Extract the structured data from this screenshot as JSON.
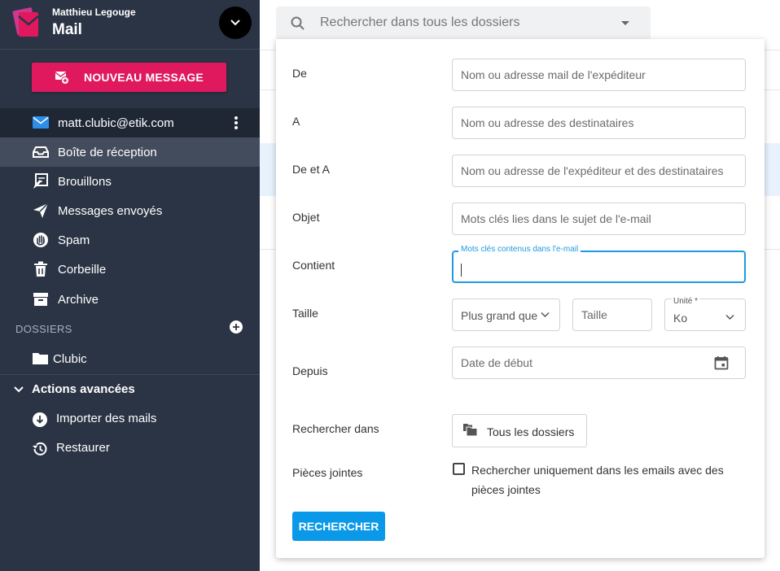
{
  "app": {
    "user_name": "Matthieu Legouge",
    "app_name": "Mail"
  },
  "sidebar": {
    "new_message_label": "NOUVEAU MESSAGE",
    "account_email": "matt.clubic@etik.com",
    "items": [
      {
        "label": "Boîte de réception",
        "icon": "inbox-icon",
        "active": true
      },
      {
        "label": "Brouillons",
        "icon": "drafts-icon"
      },
      {
        "label": "Messages envoyés",
        "icon": "send-icon"
      },
      {
        "label": "Spam",
        "icon": "spam-hand-icon"
      },
      {
        "label": "Corbeille",
        "icon": "trash-icon"
      },
      {
        "label": "Archive",
        "icon": "archive-icon"
      }
    ],
    "folders_title": "DOSSIERS",
    "folders": [
      {
        "label": "Clubic",
        "icon": "folder-icon"
      }
    ],
    "advanced_title": "Actions avancées",
    "advanced_items": [
      {
        "label": "Importer des mails",
        "icon": "download-icon"
      },
      {
        "label": "Restaurer",
        "icon": "restore-icon"
      }
    ]
  },
  "search": {
    "placeholder": "Rechercher dans tous les dossiers"
  },
  "form": {
    "from": {
      "label": "De",
      "placeholder": "Nom ou adresse mail de l'expéditeur"
    },
    "to": {
      "label": "A",
      "placeholder": "Nom ou adresse des destinataires"
    },
    "from_to": {
      "label": "De et A",
      "placeholder": "Nom ou adresse de l'expéditeur et des destinataires"
    },
    "subject": {
      "label": "Objet",
      "placeholder": "Mots clés lies dans le sujet de l'e-mail"
    },
    "contains": {
      "label": "Contient",
      "floating_label": "Mots clés contenus dans l'e-mail"
    },
    "size": {
      "label": "Taille",
      "comparator": "Plus grand que",
      "placeholder": "Taille",
      "unit_label": "Unité *",
      "unit_value": "Ko"
    },
    "since": {
      "label": "Depuis",
      "placeholder": "Date de début"
    },
    "search_in": {
      "label": "Rechercher dans",
      "button": "Tous les dossiers"
    },
    "attachments": {
      "label": "Pièces jointes",
      "checkbox_label": "Rechercher uniquement dans les emails avec des pièces jointes"
    },
    "submit": "RECHERCHER"
  },
  "colors": {
    "sidebar_bg": "#2b3444",
    "accent_pink": "#e0185e",
    "primary_blue": "#0a99e8",
    "focus_blue": "#1e9be0"
  }
}
